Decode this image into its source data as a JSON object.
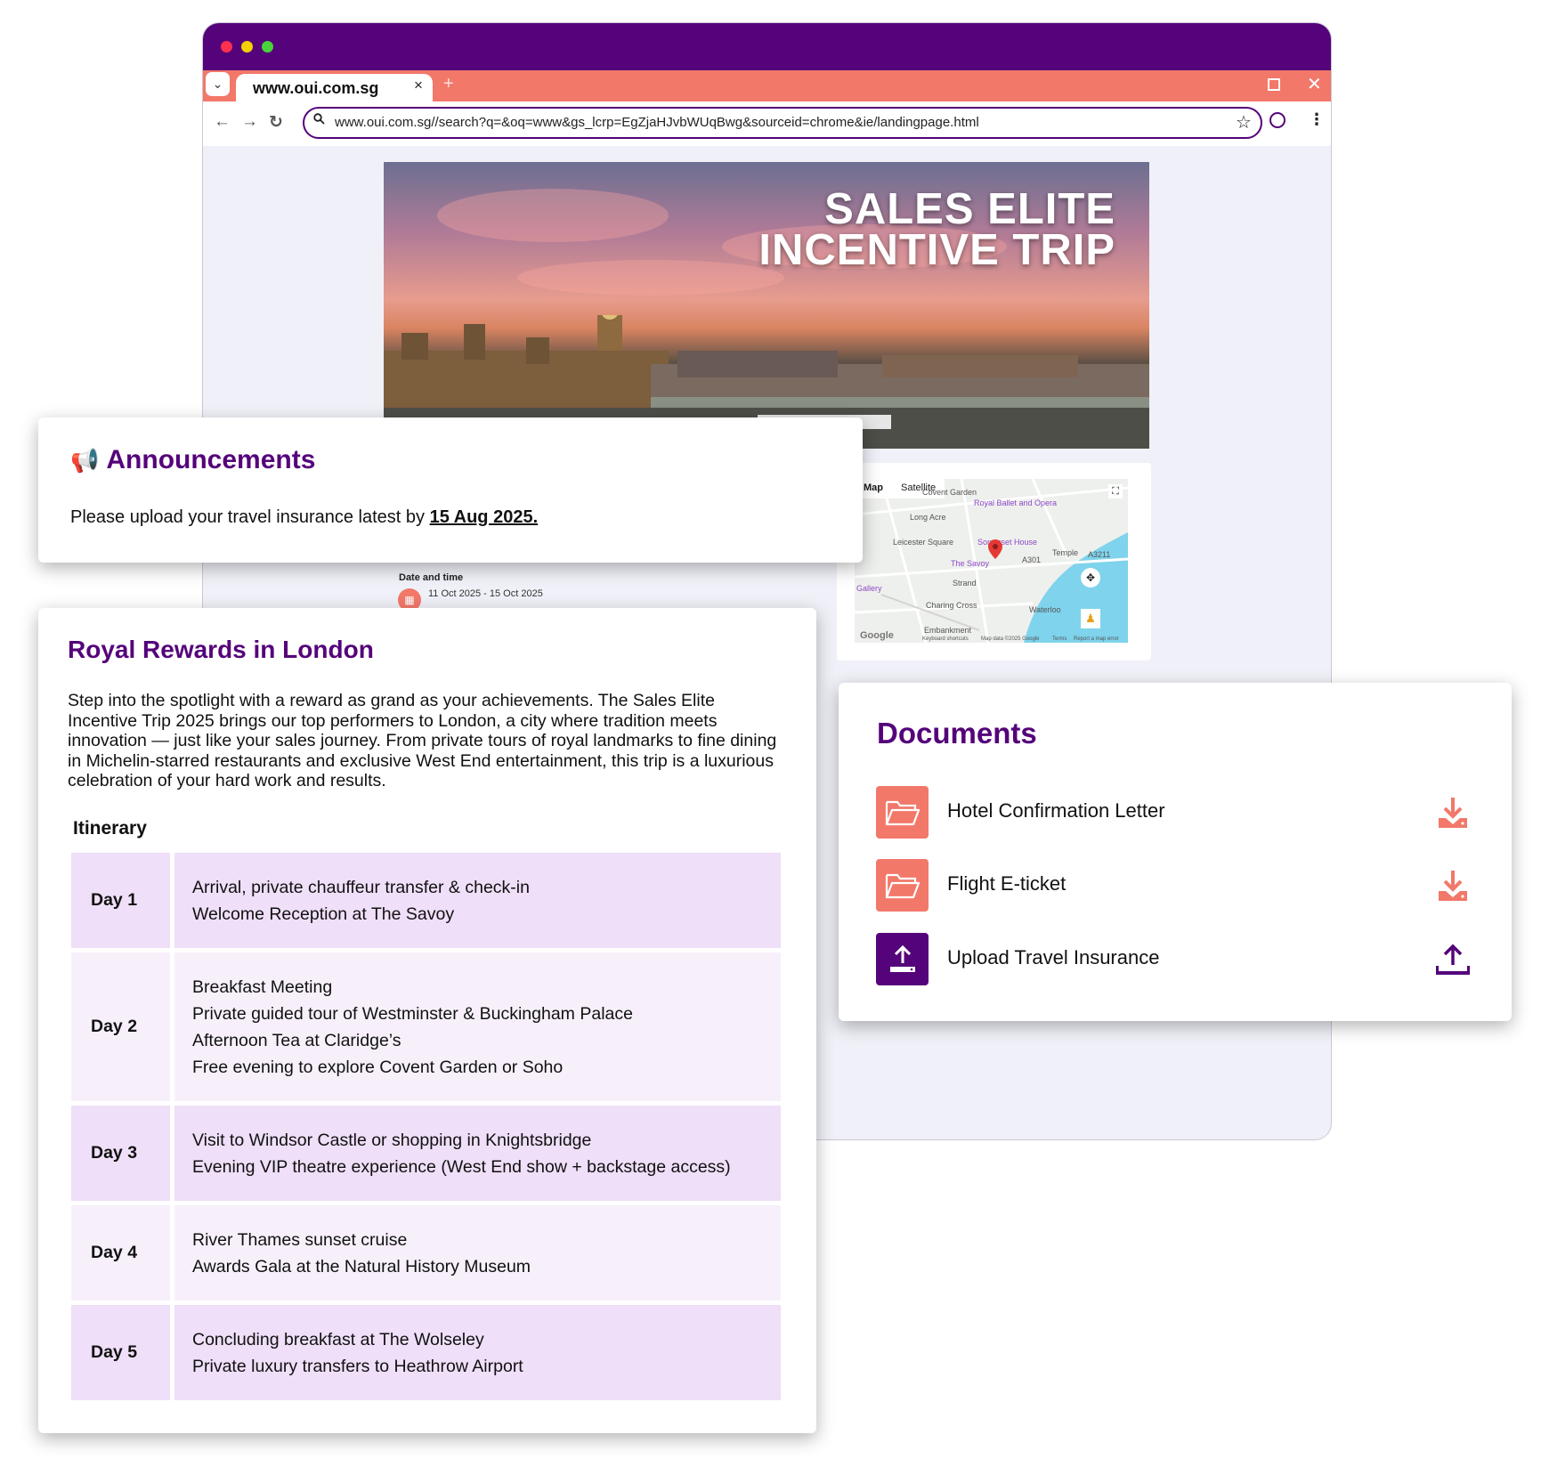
{
  "browser": {
    "tab_title": "www.oui.com.sg",
    "tab_close": "×",
    "new_tab": "+",
    "window_close": "✕",
    "url": "www.oui.com.sg//search?q=&oq=www&gs_lcrp=EgZjaHJvbWUqBwg&sourceid=chrome&ie/landingpage.html",
    "colors": {
      "titlebar": "#55037a",
      "tabbar": "#f2786a"
    }
  },
  "hero": {
    "title_line1": "SALES ELITE",
    "title_line2": "INCENTIVE TRIP"
  },
  "map": {
    "tab_map": "Map",
    "tab_satellite": "Satellite",
    "places": [
      "Royal Ballet and Opera",
      "Leicester Square",
      "Somerset House",
      "The Savoy",
      "Temple",
      "A3211",
      "Strand",
      "Gallery",
      "Charing Cross",
      "Embankment",
      "Waterloo",
      "A301",
      "Covent Garden",
      "Long Acre"
    ],
    "footer": [
      "Google",
      "Keyboard shortcuts",
      "Map data ©2025 Google",
      "Terms",
      "Report a map error"
    ]
  },
  "event": {
    "date_label": "Date and time",
    "date_value": "11 Oct 2025 - 15 Oct 2025"
  },
  "announcements": {
    "title": "Announcements",
    "text_prefix": "Please upload your travel insurance latest by ",
    "deadline": "15 Aug 2025."
  },
  "rewards": {
    "title": "Royal Rewards in London",
    "description": "Step into the spotlight with a reward as grand as your achievements. The Sales Elite Incentive Trip 2025 brings our top performers to London, a city where tradition meets innovation — just like your sales journey. From private tours of royal landmarks to fine dining in Michelin-starred restaurants and exclusive West End entertainment, this trip is a luxurious celebration of your hard work and results.",
    "itinerary_heading": "Itinerary",
    "itinerary": [
      {
        "day": "Day 1",
        "items": [
          "Arrival, private chauffeur transfer & check-in",
          "Welcome Reception at The Savoy"
        ]
      },
      {
        "day": "Day 2",
        "items": [
          "Breakfast Meeting",
          "Private guided tour of Westminster & Buckingham Palace",
          "Afternoon Tea at Claridge’s",
          "Free evening to explore Covent Garden or Soho"
        ]
      },
      {
        "day": "Day 3",
        "items": [
          "Visit to Windsor Castle or shopping in Knightsbridge",
          "Evening VIP theatre experience (West End show + backstage access)"
        ]
      },
      {
        "day": "Day 4",
        "items": [
          "River Thames sunset cruise",
          "Awards Gala at the Natural History Museum"
        ]
      },
      {
        "day": "Day 5",
        "items": [
          "Concluding breakfast at The Wolseley",
          "Private luxury transfers to Heathrow Airport"
        ]
      }
    ]
  },
  "documents": {
    "title": "Documents",
    "items": [
      {
        "label": "Hotel Confirmation Letter",
        "icon": "folder-open-icon",
        "action": "download-icon"
      },
      {
        "label": "Flight E-ticket",
        "icon": "folder-open-icon",
        "action": "download-icon"
      },
      {
        "label": "Upload Travel Insurance",
        "icon": "upload-icon",
        "action": "upload-icon"
      }
    ],
    "colors": {
      "accent": "#f2786a",
      "brand": "#55037a"
    }
  }
}
